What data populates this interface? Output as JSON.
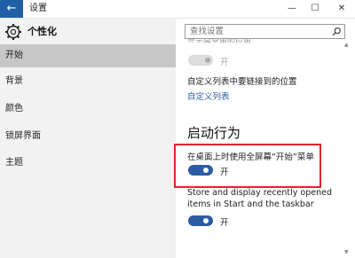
{
  "window": {
    "title": "设置",
    "back_glyph": "←",
    "minimize_glyph": "—",
    "maximize_glyph": "☐",
    "close_glyph": "✕"
  },
  "sidebar": {
    "header": "个性化",
    "items": [
      {
        "label": "开始",
        "selected": true
      },
      {
        "label": "背景",
        "selected": false
      },
      {
        "label": "颜色",
        "selected": false
      },
      {
        "label": "锁屏界面",
        "selected": false
      },
      {
        "label": "主题",
        "selected": false
      }
    ]
  },
  "search": {
    "placeholder": "查找设置"
  },
  "content": {
    "cut_off_text": "显示最常用的应用",
    "toggle_top_label": "开",
    "custom_list_title": "自定义列表中要链接到的位置",
    "custom_list_link": "自定义列表",
    "section_title": "启动行为",
    "fullscreen_label": "在桌面上时使用全屏幕“开始”菜单",
    "fullscreen_toggle_label": "开",
    "recent_label_line1": "Store and display recently opened",
    "recent_label_line2": "items in Start and the taskbar",
    "recent_toggle_label": "开"
  },
  "colors": {
    "accent": "#2b5da3",
    "back_button": "#1e5fa8",
    "highlight": "#e0262c"
  },
  "icons": {
    "header": "gear-icon",
    "search": "search-icon"
  }
}
